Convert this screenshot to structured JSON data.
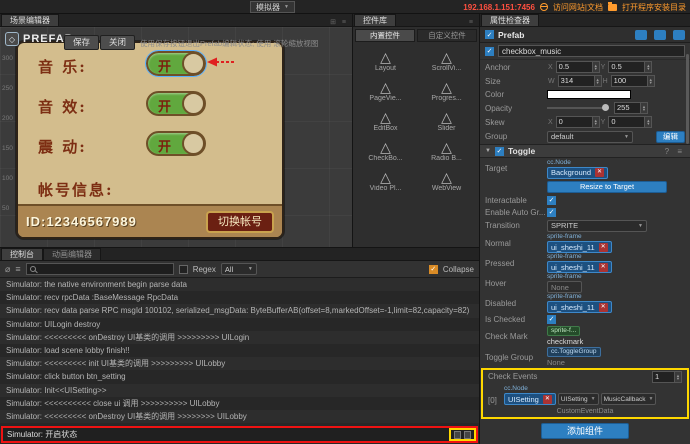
{
  "topbar": {
    "simulator": "模拟器",
    "address": "192.168.1.151:7456",
    "link_docs": "访问网站|文档",
    "link_install": "打开程序安装目录"
  },
  "scene": {
    "tab": "场景编辑器",
    "logo": "PREFAB",
    "save": "保存",
    "close": "关闭",
    "hint": "使用保存按钮退出Prefab编辑状态; 使用 滚轮缩放视图",
    "ruler": [
      "300",
      "250",
      "200",
      "150",
      "100",
      "50"
    ],
    "panel": {
      "rows": [
        {
          "label": "音 乐:",
          "state": "开"
        },
        {
          "label": "音 效:",
          "state": "开"
        },
        {
          "label": "震 动:",
          "state": "开"
        }
      ],
      "account_label": "帐号信息:",
      "account_id": "ID:12346567989",
      "switch_button": "切换帐号"
    }
  },
  "widgets": {
    "tab": "控件库",
    "subtabs": [
      "内置控件",
      "自定义控件"
    ],
    "items": [
      "Layout",
      "ScrollVi...",
      "PageVie...",
      "Progres...",
      "EditBox",
      "Slider",
      "CheckBo...",
      "Radio B...",
      "Video Pl...",
      "WebView"
    ]
  },
  "inspector": {
    "tab": "属性检查器",
    "prefab_label": "Prefab",
    "node_name": "checkbox_music",
    "anchor": {
      "label": "Anchor",
      "x_label": "X",
      "x": "0.5",
      "y_label": "Y",
      "y": "0.5"
    },
    "size": {
      "label": "Size",
      "w_label": "W",
      "w": "314",
      "h_label": "H",
      "h": "100"
    },
    "color_label": "Color",
    "opacity": {
      "label": "Opacity",
      "value": "255"
    },
    "skew": {
      "label": "Skew",
      "x_label": "X",
      "x": "0",
      "y_label": "Y",
      "y": "0"
    },
    "group": {
      "label": "Group",
      "value": "default",
      "edit": "编辑"
    },
    "toggle": {
      "title": "Toggle",
      "target": {
        "label": "Target",
        "tag": "cc.Node",
        "value": "Background"
      },
      "resize_button": "Resize to Target",
      "interactable": "Interactable",
      "enable_auto": "Enable Auto Gr...",
      "transition": {
        "label": "Transition",
        "value": "SPRITE"
      },
      "normal": {
        "label": "Normal",
        "tag": "sprite-frame",
        "value": "ui_sheshi_11"
      },
      "pressed": {
        "label": "Pressed",
        "tag": "sprite-frame",
        "value": "ui_sheshi_11"
      },
      "hover": {
        "label": "Hover",
        "tag": "sprite-frame",
        "value": "None"
      },
      "disabled": {
        "label": "Disabled",
        "tag": "sprite-frame",
        "value": "ui_sheshi_11"
      },
      "is_checked": "Is Checked",
      "check_mark": {
        "label": "Check Mark",
        "tag": "sprite-f...",
        "value": "checkmark"
      },
      "toggle_group": {
        "label": "Toggle Group",
        "tag": "cc.ToggleGroup",
        "value": "None"
      },
      "check_events": {
        "label": "Check Events",
        "count": "1"
      },
      "event0": {
        "index": "[0]",
        "tag": "cc.Node",
        "node": "UISetting",
        "component": "UISetting",
        "handler": "MusicCallback",
        "custom": "CustomEventData"
      }
    },
    "add_component": "添加组件"
  },
  "console": {
    "tabs": [
      "控制台",
      "动画编辑器"
    ],
    "regex": "Regex",
    "filter_all": "All",
    "collapse": "Collapse",
    "logs": [
      "Simulator: the native environment begin parse data",
      "Simulator: recv rpcData :BaseMessage RpcData",
      "Simulator: recv data parse RPC msgId 100102, serialized_msgData: ByteBufferAB(offset=8,markedOffset=-1,limit=82,capacity=82)",
      "Simulator: UILogin destroy",
      "Simulator: <<<<<<<<< onDestroy UI基类的调用 >>>>>>>>> UILogin",
      "Simulator: load scene lobby finish!!",
      "Simulator: <<<<<<<<< init UI基类的调用 >>>>>>>>> UILobby",
      "Simulator: click button btn_setting",
      "Simulator: Init<<UISetting>>",
      "Simulator: <<<<<<<<<< close ui 调用 >>>>>>>>>> UILobby",
      "Simulator: <<<<<<<<< onDestroy UI基类的调用 >>>>>>>> UILobby"
    ],
    "highlight_log": "Simulator: 开启状态"
  }
}
